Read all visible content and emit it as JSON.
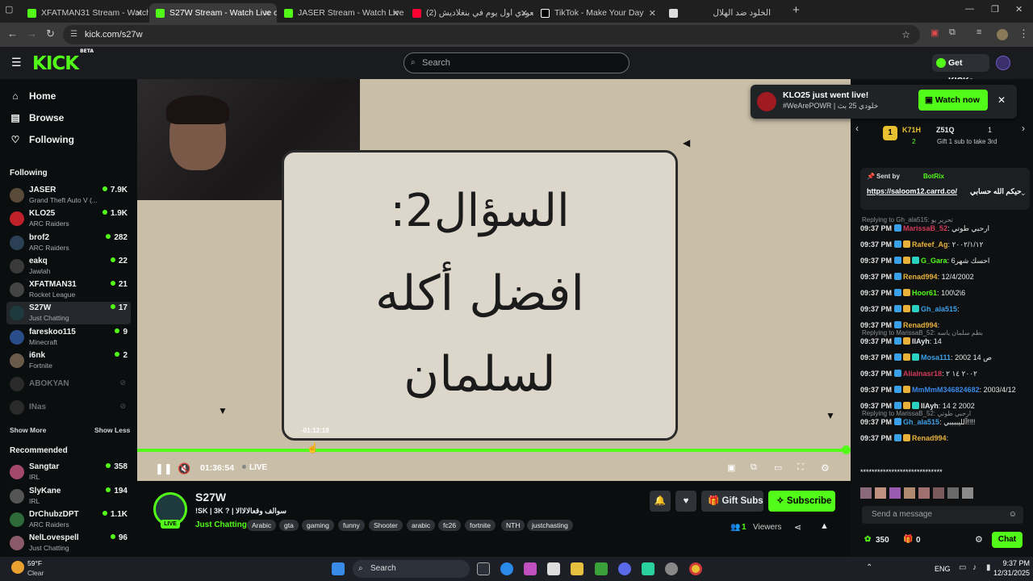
{
  "browser": {
    "tabs": [
      {
        "title": "XFATMAN31 Stream - Watch Li",
        "close": "✕",
        "fav_color": "#53fc18"
      },
      {
        "title": "S27W Stream - Watch Live on K",
        "close": "✕",
        "fav_color": "#53fc18"
      },
      {
        "title": "JASER Stream - Watch Live on K",
        "close": "✕",
        "fav_color": "#53fc18"
      },
      {
        "title": "(2) سعودي اول يوم في بنغلاديش",
        "close": "✕",
        "fav_color": "#ff0033"
      },
      {
        "title": "TikTok - Make Your Day",
        "close": "✕",
        "fav_color": "#ffffff"
      },
      {
        "title": "الخلود ضد الهلال",
        "close": "",
        "fav_color": "#ffffff"
      }
    ],
    "new_tab": "+",
    "url": "kick.com/s27w",
    "window_controls": [
      "—",
      "❐",
      "✕"
    ]
  },
  "header": {
    "logo": "KICK",
    "logo_beta": "BETA",
    "search_placeholder": "Search",
    "get_kicks": "Get KICKs"
  },
  "sidebar": {
    "nav": [
      {
        "label": "Home",
        "icon": "home-icon"
      },
      {
        "label": "Browse",
        "icon": "browse-icon"
      },
      {
        "label": "Following",
        "icon": "heart-icon"
      }
    ],
    "following_title": "Following",
    "following": [
      {
        "name": "JASER",
        "category": "Grand Theft Auto V (...",
        "viewers": "7.9K",
        "color": "#5a4a3a"
      },
      {
        "name": "KLO25",
        "category": "ARC Raiders",
        "viewers": "1.9K",
        "color": "#c0202a"
      },
      {
        "name": "brof2",
        "category": "ARC Raiders",
        "viewers": "282",
        "color": "#2b3f55"
      },
      {
        "name": "eakq",
        "category": "Jawlah",
        "viewers": "22",
        "color": "#3a3a3a"
      },
      {
        "name": "XFATMAN31",
        "category": "Rocket League",
        "viewers": "21",
        "color": "#444"
      },
      {
        "name": "S27W",
        "category": "Just Chatting",
        "viewers": "17",
        "color": "#1e3a3f"
      },
      {
        "name": "fareskoo115",
        "category": "Minecraft",
        "viewers": "9",
        "color": "#2a4d8a"
      },
      {
        "name": "i6nk",
        "category": "Fortnite",
        "viewers": "2",
        "color": "#6a5a4a"
      },
      {
        "name": "ABOKYAN",
        "category": "",
        "viewers": "",
        "color": "#2a2a2a"
      },
      {
        "name": "INas",
        "category": "",
        "viewers": "",
        "color": "#2a2a2a"
      }
    ],
    "show_more": "Show More",
    "show_less": "Show Less",
    "recommended_title": "Recommended",
    "recommended": [
      {
        "name": "Sangtar",
        "category": "IRL",
        "viewers": "358",
        "color": "#a34a6a"
      },
      {
        "name": "SlyKane",
        "category": "IRL",
        "viewers": "194",
        "color": "#555"
      },
      {
        "name": "DrChubzDPT",
        "category": "ARC Raiders",
        "viewers": "1.1K",
        "color": "#2f6b3a"
      },
      {
        "name": "NelLovespell",
        "category": "Just Chatting",
        "viewers": "96",
        "color": "#8a5a6a"
      }
    ]
  },
  "player": {
    "overlay_question": "السؤال2:",
    "overlay_line2": "افضل أكله",
    "overlay_line3": "لسلمان",
    "hover_time": "-01:12:18",
    "elapsed": "01:36:54",
    "live_label": "LIVE",
    "progress": 1.0
  },
  "stream": {
    "channel": "S27W",
    "title": "!SK | 3K ? | سوالف وقعالالاالا",
    "category": "Just Chatting",
    "tags": [
      "Arabic",
      "gta",
      "gaming",
      "funny",
      "Shooter",
      "arabic",
      "fc26",
      "fortnite",
      "NTH",
      "justchasting"
    ],
    "live_badge": "LIVE",
    "gift_subs": "Gift Subs",
    "subscribe": "Subscribe",
    "viewers": "1",
    "viewers_label": "Viewers"
  },
  "toast": {
    "title": "KLO25 just went live!",
    "subtitle": "#WeArePOWR | خلودي 25 بث",
    "button": "Watch now",
    "close": "✕"
  },
  "chat": {
    "leaderboard": {
      "rank": "1",
      "user1": "K71H",
      "count1": "2",
      "user2": "Z51Q",
      "count2": "1",
      "note": "Gift 1 sub to take 3rd"
    },
    "pinned": {
      "sent_by": "Sent by",
      "bot": "BotRix",
      "link": "https://saloom12.carrd.co/",
      "text": "حيكم الله حسابي"
    },
    "messages": [
      {
        "reply": "Replying to Gh_ala515: تحرير يو",
        "time": "09:37 PM",
        "user": "MarissaB_52",
        "color": "#d03a5a",
        "text": "ارحبي طوتي"
      },
      {
        "reply": "",
        "time": "09:37 PM",
        "user": "Rafeef_Ag",
        "color": "#e8b23a",
        "text": "٢٠٠٢/١/١٢"
      },
      {
        "reply": "",
        "time": "09:37 PM",
        "user": "G_Gara",
        "color": "#53fc18",
        "text": "احسك شهر6"
      },
      {
        "reply": "",
        "time": "09:37 PM",
        "user": "Renad994",
        "color": "#e8b23a",
        "text": "12/4/2002"
      },
      {
        "reply": "",
        "time": "09:37 PM",
        "user": "Hoor61",
        "color": "#53fc18",
        "text": "100\\2\\6"
      },
      {
        "reply": "",
        "time": "09:37 PM",
        "user": "Gh_ala515",
        "color": "#3aa0e8",
        "text": ""
      },
      {
        "reply": "",
        "time": "09:37 PM",
        "user": "Renad994",
        "color": "#e8b23a",
        "text": ""
      },
      {
        "reply": "Replying to MarissaB_52: بطم سلمان ياسه",
        "time": "09:37 PM",
        "user": "IlAyh",
        "color": "#e8e8e8",
        "text": "14"
      },
      {
        "reply": "",
        "time": "09:37 PM",
        "user": "Mosa111",
        "color": "#3aa0e8",
        "text": "2002 14 ص"
      },
      {
        "reply": "",
        "time": "09:37 PM",
        "user": "Alialnasr18",
        "color": "#d03a5a",
        "text": "٢٠٠٢ ١٤ ٢"
      },
      {
        "reply": "",
        "time": "09:37 PM",
        "user": "MmMmM346824682",
        "color": "#3a8ae8",
        "text": "2003/4/12"
      },
      {
        "reply": "",
        "time": "09:37 PM",
        "user": "IlAyh",
        "color": "#e8e8e8",
        "text": "14 2 2002"
      },
      {
        "reply": "Replying to MarissaB_52: ارحبي طوتي",
        "time": "09:37 PM",
        "user": "Gh_ala515",
        "color": "#3aa0e8",
        "text": "آلليببببي!!!!"
      },
      {
        "reply": "",
        "time": "09:37 PM",
        "user": "Renad994",
        "color": "#e8b23a",
        "text": ""
      }
    ],
    "stars_line": "*****************************",
    "input_placeholder": "Send a message",
    "kicks": "350",
    "gifts": "0",
    "chat_button": "Chat"
  },
  "taskbar": {
    "weather_temp": "59°F",
    "weather_desc": "Clear",
    "search": "Search",
    "lang": "ENG",
    "time": "9:37 PM",
    "date": "12/31/2025"
  },
  "colors": {
    "accent": "#53fc18",
    "bg": "#0b0e0f"
  }
}
